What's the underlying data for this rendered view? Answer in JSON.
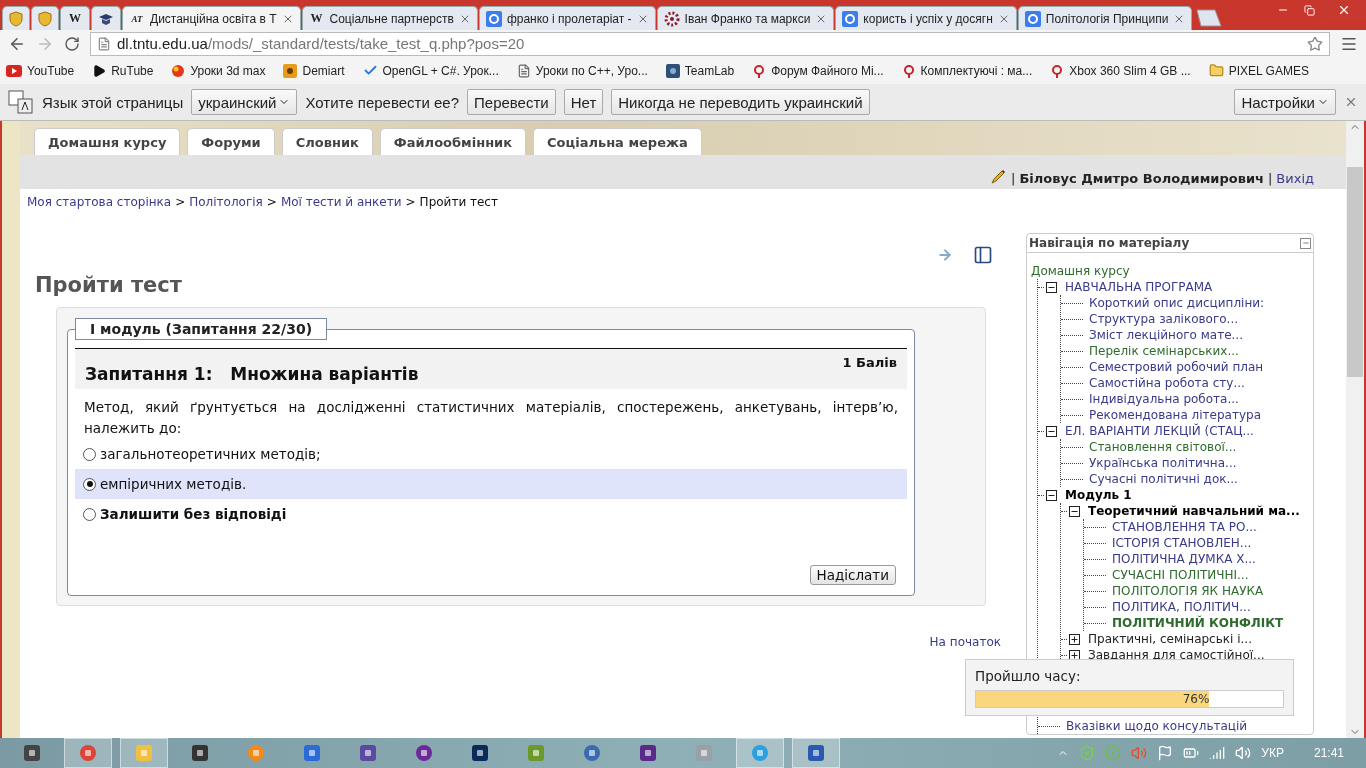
{
  "browser": {
    "tabs": [
      {
        "selected": false
      },
      {
        "selected": false
      },
      {
        "icon_text": "W",
        "selected": false
      },
      {
        "selected": false
      },
      {
        "icon_text": "AT",
        "title": "Дистанційна освіта в Т",
        "selected": true
      },
      {
        "icon_text": "W",
        "title": "Соціальне партнерств",
        "selected": false
      },
      {
        "title": "франко і пролетаріат -",
        "selected": false
      },
      {
        "title": "Іван Франко та маркси",
        "selected": false
      },
      {
        "title": "користь і успіх у досягн",
        "selected": false
      },
      {
        "title": "Політологія Принципи",
        "selected": false
      }
    ],
    "address": {
      "host": "dl.tntu.edu.ua",
      "path": "/mods/_standard/tests/take_test_q.php?pos=20"
    },
    "bookmarks": [
      {
        "label": "YouTube"
      },
      {
        "label": "RuTube"
      },
      {
        "label": "Уроки 3d max"
      },
      {
        "label": "Demiart"
      },
      {
        "label": "OpenGL + C#. Урок..."
      },
      {
        "label": "Уроки по C++, Уро..."
      },
      {
        "label": "TeamLab"
      },
      {
        "label": "Форум Файного Mi..."
      },
      {
        "label": "Комплектуючі : ма..."
      },
      {
        "label": "Xbox 360 Slim 4 GB ..."
      },
      {
        "label": "PIXEL GAMES"
      }
    ],
    "translate_bar": {
      "label": "Язык этой страницы",
      "language": "украинский",
      "question": "Хотите перевести ее?",
      "buttons": [
        "Перевести",
        "Нет",
        "Никогда не переводить украинский"
      ],
      "settings": "Настройки"
    }
  },
  "course_tabs": [
    {
      "label": "Домашня курсу"
    },
    {
      "label": "Форуми"
    },
    {
      "label": "Словник"
    },
    {
      "label": "Файлообмінник"
    },
    {
      "label": "Соціальна мережа"
    }
  ],
  "user": {
    "separator": "|",
    "name": "Біловус Дмитро Володимирович",
    "separator_2": "|",
    "logout": "Вихід"
  },
  "breadcrumb": [
    {
      "kind": "link",
      "text": "Моя стартова сторінка"
    },
    {
      "kind": "sep",
      "text": ">"
    },
    {
      "kind": "link",
      "text": "Політологія"
    },
    {
      "kind": "sep",
      "text": ">"
    },
    {
      "kind": "link",
      "text": "Мої тести й анкети"
    },
    {
      "kind": "sep",
      "text": ">"
    },
    {
      "kind": "current",
      "text": "Пройти тест"
    }
  ],
  "page_title": "Пройти тест",
  "test": {
    "legend": "I модуль (Запитання 22/30)",
    "question_title": "Запитання 1:   Множина варіантів",
    "points": "1 Балів",
    "question": "Метод, який ґрунтується на дослідженні статистичних матеріалів, спостережень, анкетувань, інтерв’ю, належить до:",
    "options": [
      {
        "label": "загальнотеоретичних методів;",
        "selected": false,
        "kind": "answer"
      },
      {
        "label": "емпіричних методів.",
        "selected": true,
        "kind": "answer"
      },
      {
        "label": "Залишити без відповіді",
        "selected": false,
        "kind": "skip"
      }
    ],
    "submit": "Надіслати"
  },
  "to_top": "На початок",
  "navigation": {
    "title": "Навігація по матеріалу",
    "home": "Домашня курсу",
    "tree": [
      {
        "label": "НАВЧАЛЬНА ПРОГРАМА",
        "kind": "link",
        "color": "#3a3a8a",
        "expanded": true,
        "children": [
          {
            "label": "Короткий опис дисципліни:",
            "kind": "link",
            "color": "#3a3a8a"
          },
          {
            "label": "Структура залікового...",
            "kind": "link",
            "color": "#3a3a8a"
          },
          {
            "label": "Зміст лекційного мате...",
            "kind": "link",
            "color": "#3a3a8a"
          },
          {
            "label": "Перелік семінарських...",
            "kind": "link",
            "color": "#2f6a2f"
          },
          {
            "label": "Семестровий робочий план",
            "kind": "link",
            "color": "#3a3a8a"
          },
          {
            "label": "Самостійна робота сту...",
            "kind": "link",
            "color": "#3a3a8a"
          },
          {
            "label": "Індивідуальна робота...",
            "kind": "link",
            "color": "#3a3a8a"
          },
          {
            "label": "Рекомендована література",
            "kind": "link",
            "color": "#3a3a8a"
          }
        ]
      },
      {
        "label": "ЕЛ. ВАРІАНТИ ЛЕКЦІЙ (СТАЦ...",
        "kind": "link",
        "color": "#3a3a8a",
        "expanded": true,
        "children": [
          {
            "label": "Становлення світової...",
            "kind": "link",
            "color": "#2f6a2f"
          },
          {
            "label": "Українська політична...",
            "kind": "link",
            "color": "#3a3a8a"
          },
          {
            "label": "Сучасні політичні док...",
            "kind": "link",
            "color": "#3a3a8a"
          }
        ]
      },
      {
        "label": "Модуль 1",
        "kind": "heading",
        "color": "#000000",
        "expanded": true,
        "children": [
          {
            "label": "Теоретичний навчальний ма...",
            "kind": "heading",
            "color": "#000000",
            "expanded": true,
            "children": [
              {
                "label": "СТАНОВЛЕННЯ ТА РО...",
                "kind": "link",
                "color": "#3a3a8a"
              },
              {
                "label": "ІСТОРІЯ СТАНОВЛЕН...",
                "kind": "link",
                "color": "#3a3a8a"
              },
              {
                "label": "ПОЛІТИЧНА ДУМКА Х...",
                "kind": "link",
                "color": "#3a3a8a"
              },
              {
                "label": "СУЧАСНІ ПОЛІТИЧНІ...",
                "kind": "link",
                "color": "#2f6a2f"
              },
              {
                "label": "ПОЛІТОЛОГІЯ ЯК НАУКА",
                "kind": "link",
                "color": "#2f6a2f"
              },
              {
                "label": "ПОЛІТИКА, ПОЛІТИЧ...",
                "kind": "link",
                "color": "#3a3a8a"
              },
              {
                "label": "ПОЛІТИЧНИЙ КОНФЛІКТ",
                "kind": "current",
                "color": "#2f6a2f"
              }
            ]
          },
          {
            "label": "Практичні, семінарські і...",
            "kind": "link",
            "color": "#222222",
            "expanded": false
          },
          {
            "label": "Завдання для самостійної...",
            "kind": "link",
            "color": "#222222",
            "expanded": false
          }
        ]
      },
      {
        "label": "Вказівки щодо консультацій",
        "kind": "link",
        "color": "#3a3a8a"
      }
    ]
  },
  "timer": {
    "label": "Пройшло часу:",
    "level": 0.76,
    "reading": "76%"
  },
  "taskbar": {
    "apps": [
      {
        "open": false
      },
      {
        "open": true
      },
      {
        "open": true
      },
      {
        "open": false
      },
      {
        "open": false
      },
      {
        "open": false
      },
      {
        "open": false
      },
      {
        "open": false
      },
      {
        "open": false
      },
      {
        "open": false
      },
      {
        "open": false
      },
      {
        "open": false
      },
      {
        "open": false
      },
      {
        "open": true
      },
      {
        "open": true
      }
    ],
    "language": "УКР",
    "time": "21:41"
  }
}
